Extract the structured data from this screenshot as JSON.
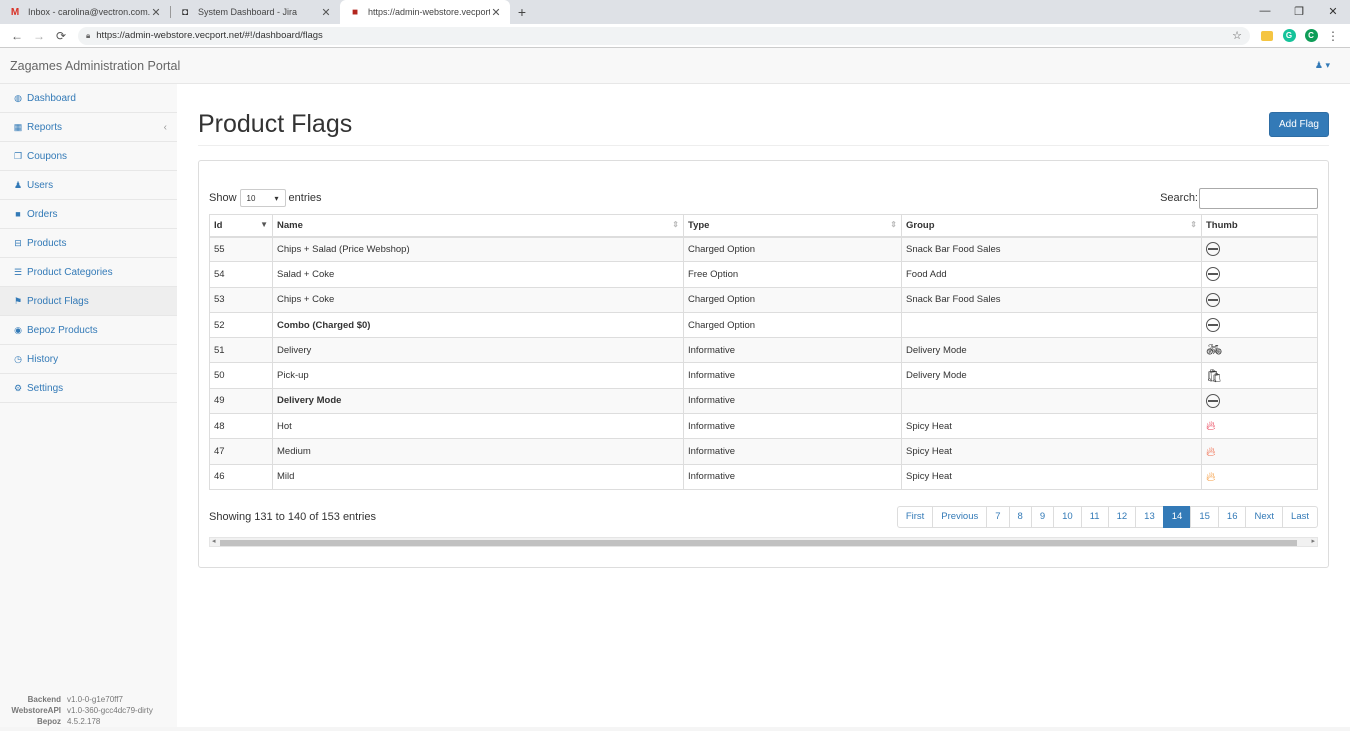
{
  "browser": {
    "tabs": [
      {
        "title": "Inbox - carolina@vectron.com.au",
        "icon": "gmail-icon",
        "icon_glyph": "M",
        "icon_color": "#d93025"
      },
      {
        "title": "System Dashboard - Jira",
        "icon": "jira-icon",
        "icon_glyph": "◘",
        "icon_color": "#333333"
      },
      {
        "title": "https://admin-webstore.vecport.n",
        "icon": "site-icon",
        "icon_glyph": "■",
        "icon_color": "#b3261e"
      }
    ],
    "url": "https://admin-webstore.vecport.net/#!/dashboard/flags",
    "profile_initial": "C",
    "grammarly_initial": "G"
  },
  "app": {
    "brand": "Zagames Administration Portal",
    "user_icon": "user-icon"
  },
  "sidebar": {
    "items": [
      {
        "label": "Dashboard",
        "icon": "dashboard-icon",
        "glyph": "◍"
      },
      {
        "label": "Reports",
        "icon": "chart-icon",
        "glyph": "▦",
        "chevron": "‹"
      },
      {
        "label": "Coupons",
        "icon": "copy-icon",
        "glyph": "❐"
      },
      {
        "label": "Users",
        "icon": "user-icon",
        "glyph": "♟"
      },
      {
        "label": "Orders",
        "icon": "truck-icon",
        "glyph": "■"
      },
      {
        "label": "Products",
        "icon": "hdd-icon",
        "glyph": "⊟"
      },
      {
        "label": "Product Categories",
        "icon": "list-icon",
        "glyph": "☰"
      },
      {
        "label": "Product Flags",
        "icon": "flag-icon",
        "glyph": "⚑"
      },
      {
        "label": "Bepoz Products",
        "icon": "bullseye-icon",
        "glyph": "◉"
      },
      {
        "label": "History",
        "icon": "history-icon",
        "glyph": "◷"
      },
      {
        "label": "Settings",
        "icon": "gear-icon",
        "glyph": "⚙"
      }
    ],
    "active_index": 7,
    "versions": [
      {
        "key": "Backend",
        "value": "v1.0-0-g1e70ff7"
      },
      {
        "key": "WebstoreAPI",
        "value": "v1.0-360-gcc4dc79-dirty"
      },
      {
        "key": "Bepoz",
        "value": "4.5.2.178"
      }
    ]
  },
  "page": {
    "title": "Product Flags",
    "add_button": "Add Flag"
  },
  "table_controls": {
    "show_label": "Show",
    "length_value": "10",
    "entries_label": "entries",
    "search_label": "Search:"
  },
  "table": {
    "headers": [
      "Id",
      "Name",
      "Type",
      "Group",
      "Thumb"
    ],
    "rows": [
      {
        "id": "55",
        "name": "Chips + Salad (Price Webshop)",
        "type": "Charged Option",
        "group": "Snack Bar Food Sales",
        "thumb": "logo-icon",
        "bold": false
      },
      {
        "id": "54",
        "name": "Salad + Coke",
        "type": "Free Option",
        "group": "Food Add",
        "thumb": "logo-icon",
        "bold": false
      },
      {
        "id": "53",
        "name": "Chips + Coke",
        "type": "Charged Option",
        "group": "Snack Bar Food Sales",
        "thumb": "logo-icon",
        "bold": false
      },
      {
        "id": "52",
        "name": "Combo (Charged $0)",
        "type": "Charged Option",
        "group": "",
        "thumb": "logo-icon",
        "bold": true
      },
      {
        "id": "51",
        "name": "Delivery",
        "type": "Informative",
        "group": "Delivery Mode",
        "thumb": "bicycle-icon",
        "bold": false
      },
      {
        "id": "50",
        "name": "Pick-up",
        "type": "Informative",
        "group": "Delivery Mode",
        "thumb": "bag-icon",
        "bold": false
      },
      {
        "id": "49",
        "name": "Delivery Mode",
        "type": "Informative",
        "group": "",
        "thumb": "logo-icon",
        "bold": true
      },
      {
        "id": "48",
        "name": "Hot",
        "type": "Informative",
        "group": "Spicy Heat",
        "thumb": "flame-hot-icon",
        "bold": false
      },
      {
        "id": "47",
        "name": "Medium",
        "type": "Informative",
        "group": "Spicy Heat",
        "thumb": "flame-medium-icon",
        "bold": false
      },
      {
        "id": "46",
        "name": "Mild",
        "type": "Informative",
        "group": "Spicy Heat",
        "thumb": "flame-mild-icon",
        "bold": false
      }
    ],
    "thumb_colors": {
      "flame-hot-icon": "#e8384f",
      "flame-medium-icon": "#f06a4a",
      "flame-mild-icon": "#f59a3c"
    }
  },
  "footer": {
    "info": "Showing 131 to 140 of 153 entries",
    "pages": [
      "First",
      "Previous",
      "7",
      "8",
      "9",
      "10",
      "11",
      "12",
      "13",
      "14",
      "15",
      "16",
      "Next",
      "Last"
    ],
    "current": "14"
  }
}
